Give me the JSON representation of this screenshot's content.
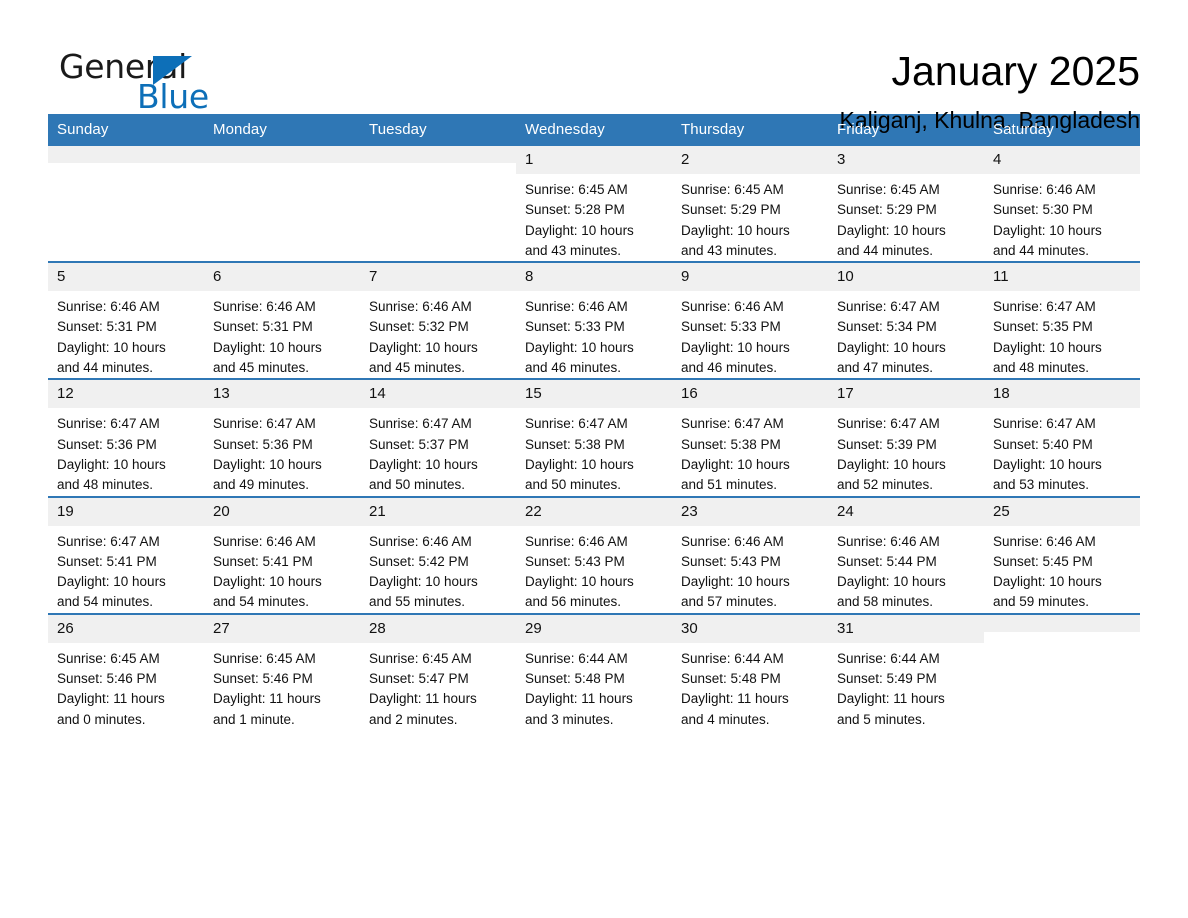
{
  "brand": {
    "name_part1": "General",
    "name_part2": "Blue",
    "accent_color": "#0d6fb8"
  },
  "header": {
    "title": "January 2025",
    "location": "Kaliganj, Khulna, Bangladesh"
  },
  "theme": {
    "header_blue": "#2f77b5",
    "daynum_band": "#f0f0f0",
    "text": "#111111"
  },
  "weekdays": [
    "Sunday",
    "Monday",
    "Tuesday",
    "Wednesday",
    "Thursday",
    "Friday",
    "Saturday"
  ],
  "weeks": [
    [
      {
        "day": "",
        "empty": true
      },
      {
        "day": "",
        "empty": true
      },
      {
        "day": "",
        "empty": true
      },
      {
        "day": "1",
        "sunrise": "Sunrise: 6:45 AM",
        "sunset": "Sunset: 5:28 PM",
        "daylight_line1": "Daylight: 10 hours",
        "daylight_line2": "and 43 minutes."
      },
      {
        "day": "2",
        "sunrise": "Sunrise: 6:45 AM",
        "sunset": "Sunset: 5:29 PM",
        "daylight_line1": "Daylight: 10 hours",
        "daylight_line2": "and 43 minutes."
      },
      {
        "day": "3",
        "sunrise": "Sunrise: 6:45 AM",
        "sunset": "Sunset: 5:29 PM",
        "daylight_line1": "Daylight: 10 hours",
        "daylight_line2": "and 44 minutes."
      },
      {
        "day": "4",
        "sunrise": "Sunrise: 6:46 AM",
        "sunset": "Sunset: 5:30 PM",
        "daylight_line1": "Daylight: 10 hours",
        "daylight_line2": "and 44 minutes."
      }
    ],
    [
      {
        "day": "5",
        "sunrise": "Sunrise: 6:46 AM",
        "sunset": "Sunset: 5:31 PM",
        "daylight_line1": "Daylight: 10 hours",
        "daylight_line2": "and 44 minutes."
      },
      {
        "day": "6",
        "sunrise": "Sunrise: 6:46 AM",
        "sunset": "Sunset: 5:31 PM",
        "daylight_line1": "Daylight: 10 hours",
        "daylight_line2": "and 45 minutes."
      },
      {
        "day": "7",
        "sunrise": "Sunrise: 6:46 AM",
        "sunset": "Sunset: 5:32 PM",
        "daylight_line1": "Daylight: 10 hours",
        "daylight_line2": "and 45 minutes."
      },
      {
        "day": "8",
        "sunrise": "Sunrise: 6:46 AM",
        "sunset": "Sunset: 5:33 PM",
        "daylight_line1": "Daylight: 10 hours",
        "daylight_line2": "and 46 minutes."
      },
      {
        "day": "9",
        "sunrise": "Sunrise: 6:46 AM",
        "sunset": "Sunset: 5:33 PM",
        "daylight_line1": "Daylight: 10 hours",
        "daylight_line2": "and 46 minutes."
      },
      {
        "day": "10",
        "sunrise": "Sunrise: 6:47 AM",
        "sunset": "Sunset: 5:34 PM",
        "daylight_line1": "Daylight: 10 hours",
        "daylight_line2": "and 47 minutes."
      },
      {
        "day": "11",
        "sunrise": "Sunrise: 6:47 AM",
        "sunset": "Sunset: 5:35 PM",
        "daylight_line1": "Daylight: 10 hours",
        "daylight_line2": "and 48 minutes."
      }
    ],
    [
      {
        "day": "12",
        "sunrise": "Sunrise: 6:47 AM",
        "sunset": "Sunset: 5:36 PM",
        "daylight_line1": "Daylight: 10 hours",
        "daylight_line2": "and 48 minutes."
      },
      {
        "day": "13",
        "sunrise": "Sunrise: 6:47 AM",
        "sunset": "Sunset: 5:36 PM",
        "daylight_line1": "Daylight: 10 hours",
        "daylight_line2": "and 49 minutes."
      },
      {
        "day": "14",
        "sunrise": "Sunrise: 6:47 AM",
        "sunset": "Sunset: 5:37 PM",
        "daylight_line1": "Daylight: 10 hours",
        "daylight_line2": "and 50 minutes."
      },
      {
        "day": "15",
        "sunrise": "Sunrise: 6:47 AM",
        "sunset": "Sunset: 5:38 PM",
        "daylight_line1": "Daylight: 10 hours",
        "daylight_line2": "and 50 minutes."
      },
      {
        "day": "16",
        "sunrise": "Sunrise: 6:47 AM",
        "sunset": "Sunset: 5:38 PM",
        "daylight_line1": "Daylight: 10 hours",
        "daylight_line2": "and 51 minutes."
      },
      {
        "day": "17",
        "sunrise": "Sunrise: 6:47 AM",
        "sunset": "Sunset: 5:39 PM",
        "daylight_line1": "Daylight: 10 hours",
        "daylight_line2": "and 52 minutes."
      },
      {
        "day": "18",
        "sunrise": "Sunrise: 6:47 AM",
        "sunset": "Sunset: 5:40 PM",
        "daylight_line1": "Daylight: 10 hours",
        "daylight_line2": "and 53 minutes."
      }
    ],
    [
      {
        "day": "19",
        "sunrise": "Sunrise: 6:47 AM",
        "sunset": "Sunset: 5:41 PM",
        "daylight_line1": "Daylight: 10 hours",
        "daylight_line2": "and 54 minutes."
      },
      {
        "day": "20",
        "sunrise": "Sunrise: 6:46 AM",
        "sunset": "Sunset: 5:41 PM",
        "daylight_line1": "Daylight: 10 hours",
        "daylight_line2": "and 54 minutes."
      },
      {
        "day": "21",
        "sunrise": "Sunrise: 6:46 AM",
        "sunset": "Sunset: 5:42 PM",
        "daylight_line1": "Daylight: 10 hours",
        "daylight_line2": "and 55 minutes."
      },
      {
        "day": "22",
        "sunrise": "Sunrise: 6:46 AM",
        "sunset": "Sunset: 5:43 PM",
        "daylight_line1": "Daylight: 10 hours",
        "daylight_line2": "and 56 minutes."
      },
      {
        "day": "23",
        "sunrise": "Sunrise: 6:46 AM",
        "sunset": "Sunset: 5:43 PM",
        "daylight_line1": "Daylight: 10 hours",
        "daylight_line2": "and 57 minutes."
      },
      {
        "day": "24",
        "sunrise": "Sunrise: 6:46 AM",
        "sunset": "Sunset: 5:44 PM",
        "daylight_line1": "Daylight: 10 hours",
        "daylight_line2": "and 58 minutes."
      },
      {
        "day": "25",
        "sunrise": "Sunrise: 6:46 AM",
        "sunset": "Sunset: 5:45 PM",
        "daylight_line1": "Daylight: 10 hours",
        "daylight_line2": "and 59 minutes."
      }
    ],
    [
      {
        "day": "26",
        "sunrise": "Sunrise: 6:45 AM",
        "sunset": "Sunset: 5:46 PM",
        "daylight_line1": "Daylight: 11 hours",
        "daylight_line2": "and 0 minutes."
      },
      {
        "day": "27",
        "sunrise": "Sunrise: 6:45 AM",
        "sunset": "Sunset: 5:46 PM",
        "daylight_line1": "Daylight: 11 hours",
        "daylight_line2": "and 1 minute."
      },
      {
        "day": "28",
        "sunrise": "Sunrise: 6:45 AM",
        "sunset": "Sunset: 5:47 PM",
        "daylight_line1": "Daylight: 11 hours",
        "daylight_line2": "and 2 minutes."
      },
      {
        "day": "29",
        "sunrise": "Sunrise: 6:44 AM",
        "sunset": "Sunset: 5:48 PM",
        "daylight_line1": "Daylight: 11 hours",
        "daylight_line2": "and 3 minutes."
      },
      {
        "day": "30",
        "sunrise": "Sunrise: 6:44 AM",
        "sunset": "Sunset: 5:48 PM",
        "daylight_line1": "Daylight: 11 hours",
        "daylight_line2": "and 4 minutes."
      },
      {
        "day": "31",
        "sunrise": "Sunrise: 6:44 AM",
        "sunset": "Sunset: 5:49 PM",
        "daylight_line1": "Daylight: 11 hours",
        "daylight_line2": "and 5 minutes."
      },
      {
        "day": "",
        "empty": true
      }
    ]
  ]
}
